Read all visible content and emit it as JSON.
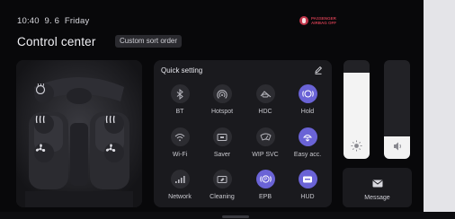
{
  "status": {
    "time": "10:40",
    "date": "9. 6",
    "weekday": "Friday"
  },
  "airbag": {
    "line1": "PASSENGER",
    "line2": "AIRBAG OFF"
  },
  "header": {
    "title": "Control center",
    "sort_button": "Custom sort order"
  },
  "quick_setting": {
    "title": "Quick setting",
    "items": [
      {
        "label": "BT",
        "icon": "bluetooth-icon",
        "active": false
      },
      {
        "label": "Hotspot",
        "icon": "hotspot-icon",
        "active": false
      },
      {
        "label": "HDC",
        "icon": "hill-descent-icon",
        "active": false
      },
      {
        "label": "Hold",
        "icon": "auto-hold-icon",
        "active": true
      },
      {
        "label": "Wi-Fi",
        "icon": "wifi-icon",
        "active": false
      },
      {
        "label": "Saver",
        "icon": "screen-saver-icon",
        "active": false
      },
      {
        "label": "WIP SVC",
        "icon": "wiper-service-icon",
        "active": false
      },
      {
        "label": "Easy acc.",
        "icon": "easy-access-icon",
        "active": true
      },
      {
        "label": "Network",
        "icon": "signal-icon",
        "active": false
      },
      {
        "label": "Cleaning",
        "icon": "screen-cleaning-icon",
        "active": false
      },
      {
        "label": "EPB",
        "icon": "parking-brake-icon",
        "active": true
      },
      {
        "label": "HUD",
        "icon": "hud-icon",
        "active": true
      }
    ]
  },
  "brightness": {
    "icon": "sun-icon",
    "level": 0.87
  },
  "volume": {
    "icon": "speaker-icon",
    "level": 0.23
  },
  "message": {
    "label": "Message",
    "icon": "envelope-icon"
  },
  "colors": {
    "accent": "#6a63d6",
    "panel": "#1a1a1e",
    "background": "#08080a",
    "airbag": "#c23a4c"
  }
}
